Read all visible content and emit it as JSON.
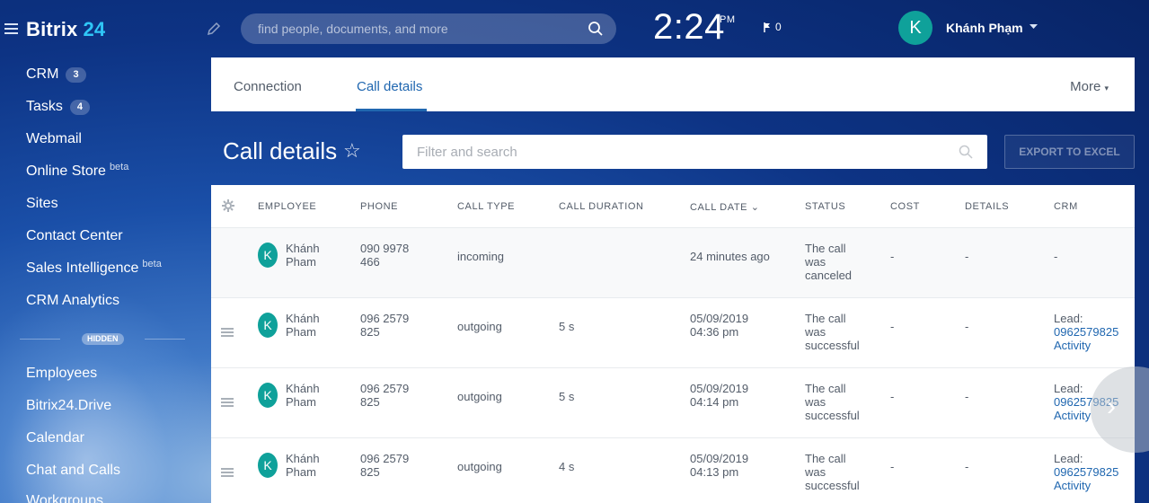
{
  "header": {
    "logo_text": "Bitrix",
    "logo_num": "24",
    "search_placeholder": "find people, documents, and more",
    "clock_time": "2:24",
    "clock_period": "PM",
    "flag_count": "0",
    "user_initial": "K",
    "user_name": "Khánh Phạm"
  },
  "sidebar": {
    "items": [
      {
        "label": "CRM",
        "badge": "3"
      },
      {
        "label": "Tasks",
        "badge": "4"
      },
      {
        "label": "Webmail"
      },
      {
        "label": "Online Store",
        "sup": "beta"
      },
      {
        "label": "Sites"
      },
      {
        "label": "Contact Center"
      },
      {
        "label": "Sales Intelligence",
        "sup": "beta"
      },
      {
        "label": "CRM Analytics"
      },
      {
        "label": "Employees"
      },
      {
        "label": "Bitrix24.Drive"
      },
      {
        "label": "Calendar"
      },
      {
        "label": "Chat and Calls"
      },
      {
        "label": "Workgroups"
      }
    ],
    "hidden_label": "HIDDEN"
  },
  "tabs": {
    "connection": "Connection",
    "call_details": "Call details",
    "more": "More"
  },
  "page": {
    "title": "Call details",
    "filter_placeholder": "Filter and search",
    "export_label": "EXPORT TO EXCEL"
  },
  "table": {
    "columns": [
      "EMPLOYEE",
      "PHONE",
      "CALL TYPE",
      "CALL DURATION",
      "CALL DATE",
      "STATUS",
      "COST",
      "DETAILS",
      "CRM"
    ],
    "rows": [
      {
        "initial": "K",
        "employee_l1": "Khánh",
        "employee_l2": "Pham",
        "phone_l1": "090 9978",
        "phone_l2": "466",
        "type": "incoming",
        "duration": "",
        "date_l1": "24 minutes ago",
        "date_l2": "",
        "status_l1": "The call",
        "status_l2": "was",
        "status_l3": "canceled",
        "cost": "-",
        "details": "-",
        "crm_l1": "-",
        "crm_l2": "",
        "crm_l3": ""
      },
      {
        "initial": "K",
        "employee_l1": "Khánh",
        "employee_l2": "Pham",
        "phone_l1": "096 2579",
        "phone_l2": "825",
        "type": "outgoing",
        "duration": "5 s",
        "date_l1": "05/09/2019",
        "date_l2": "04:36 pm",
        "status_l1": "The call",
        "status_l2": "was",
        "status_l3": "successful",
        "cost": "-",
        "details": "-",
        "crm_l1": "Lead:",
        "crm_l2": "0962579825",
        "crm_l3": "Activity"
      },
      {
        "initial": "K",
        "employee_l1": "Khánh",
        "employee_l2": "Pham",
        "phone_l1": "096 2579",
        "phone_l2": "825",
        "type": "outgoing",
        "duration": "5 s",
        "date_l1": "05/09/2019",
        "date_l2": "04:14 pm",
        "status_l1": "The call",
        "status_l2": "was",
        "status_l3": "successful",
        "cost": "-",
        "details": "-",
        "crm_l1": "Lead:",
        "crm_l2": "0962579825",
        "crm_l3": "Activity"
      },
      {
        "initial": "K",
        "employee_l1": "Khánh",
        "employee_l2": "Pham",
        "phone_l1": "096 2579",
        "phone_l2": "825",
        "type": "outgoing",
        "duration": "4 s",
        "date_l1": "05/09/2019",
        "date_l2": "04:13 pm",
        "status_l1": "The call",
        "status_l2": "was",
        "status_l3": "successful",
        "cost": "-",
        "details": "-",
        "crm_l1": "Lead:",
        "crm_l2": "0962579825",
        "crm_l3": "Activity"
      }
    ]
  },
  "colors": {
    "accent": "#2067b0",
    "logo_accent": "#2fc6f6",
    "avatar": "#0fa19a"
  }
}
